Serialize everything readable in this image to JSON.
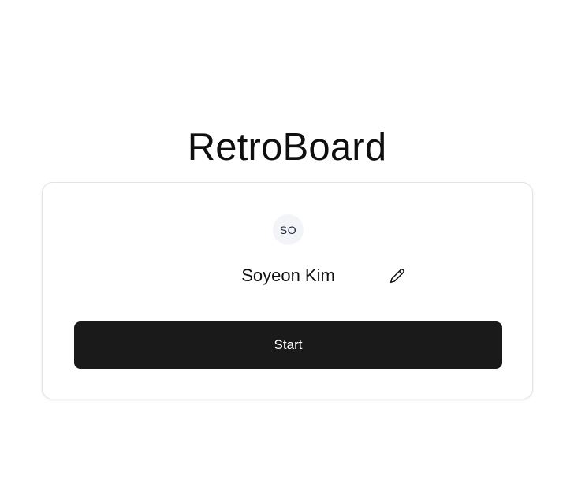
{
  "app": {
    "title": "RetroBoard"
  },
  "profile": {
    "avatar_initials": "SO",
    "name": "Soyeon Kim",
    "edit_icon": "pencil-icon"
  },
  "actions": {
    "start_label": "Start"
  },
  "colors": {
    "button_bg": "#1a1a1a",
    "button_text": "#ffffff",
    "avatar_bg": "#f3f4f7",
    "card_border": "#e3e3e6"
  }
}
